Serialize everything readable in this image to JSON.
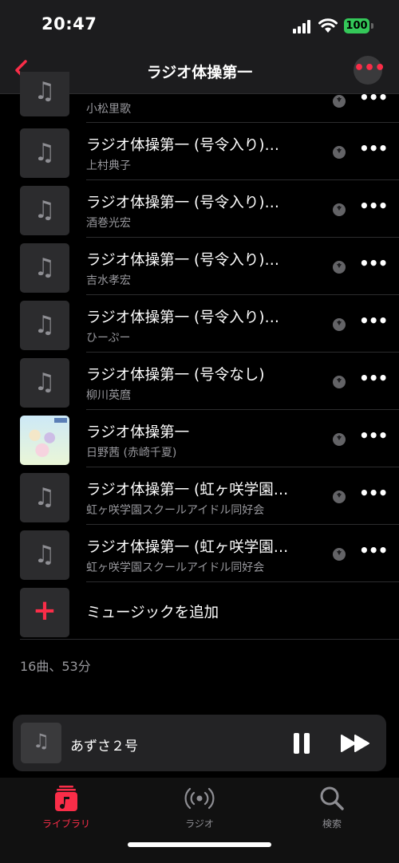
{
  "status": {
    "time": "20:47",
    "battery": "100"
  },
  "nav": {
    "title": "ラジオ体操第一",
    "more": "•••"
  },
  "tracks": [
    {
      "title": "",
      "subtitle": "小松里歌"
    },
    {
      "title": "ラジオ体操第一 (号令入り)…",
      "subtitle": "上村典子"
    },
    {
      "title": "ラジオ体操第一 (号令入り)…",
      "subtitle": "酒巻光宏"
    },
    {
      "title": "ラジオ体操第一 (号令入り)…",
      "subtitle": "吉水孝宏"
    },
    {
      "title": "ラジオ体操第一 (号令入り)…",
      "subtitle": "ひーぷー"
    },
    {
      "title": "ラジオ体操第一 (号令なし)",
      "subtitle": "柳川英麿"
    },
    {
      "title": "ラジオ体操第一",
      "subtitle": "日野茜 (赤崎千夏)"
    },
    {
      "title": "ラジオ体操第一 (虹ヶ咲学園…",
      "subtitle": "虹ヶ咲学園スクールアイドル同好会"
    },
    {
      "title": "ラジオ体操第一 (虹ヶ咲学園…",
      "subtitle": "虹ヶ咲学園スクールアイドル同好会"
    }
  ],
  "row_more": "•••",
  "add_music": {
    "icon": "+",
    "label": "ミュージックを追加"
  },
  "summary": "16曲、53分",
  "mini_player": {
    "title": "あずさ２号"
  },
  "tabs": [
    {
      "label": "ライブラリ",
      "active": true
    },
    {
      "label": "ラジオ",
      "active": false
    },
    {
      "label": "検索",
      "active": false
    }
  ],
  "colors": {
    "accent": "#fa2d48",
    "battery": "#34c759"
  }
}
